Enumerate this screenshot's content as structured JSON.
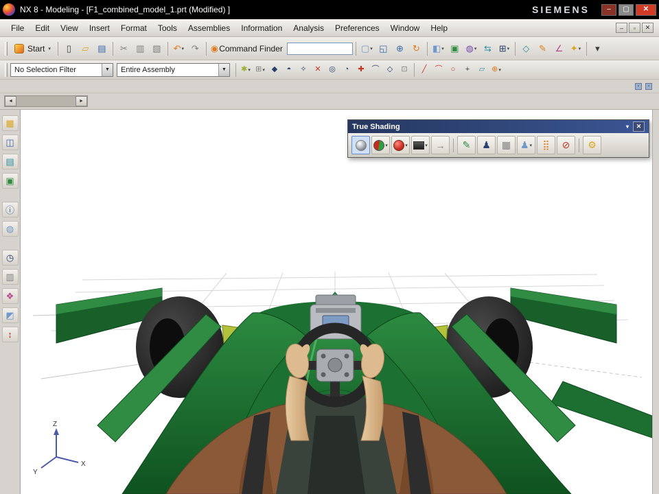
{
  "ui": {
    "caret": "▾",
    "combo_arrow": "▼",
    "scroll_left": "◄",
    "scroll_right": "►",
    "close": "✕"
  },
  "window": {
    "title": "NX 8 - Modeling - [F1_combined_model_1.prt (Modified) ]",
    "brand": "SIEMENS",
    "controls": [
      {
        "name": "minimize",
        "glyph": "–"
      },
      {
        "name": "maximize",
        "glyph": "▢"
      },
      {
        "name": "close",
        "glyph": "✕"
      }
    ]
  },
  "menu": {
    "items": [
      "File",
      "Edit",
      "View",
      "Insert",
      "Format",
      "Tools",
      "Assemblies",
      "Information",
      "Analysis",
      "Preferences",
      "Window",
      "Help"
    ],
    "doc_controls": [
      {
        "name": "minimize-document",
        "glyph": "–"
      },
      {
        "name": "restore-document",
        "glyph": "▫"
      },
      {
        "name": "close-document",
        "glyph": "✕"
      }
    ]
  },
  "toolbar_main": {
    "start_label": "Start",
    "command_finder_label": "Command Finder",
    "command_finder_value": "",
    "icons": [
      {
        "name": "new-file",
        "glyph": "▯"
      },
      {
        "name": "open-file",
        "glyph": "▱"
      },
      {
        "name": "save",
        "glyph": "▤"
      },
      {
        "name": "cut",
        "glyph": "✂"
      },
      {
        "name": "copy",
        "glyph": "▥"
      },
      {
        "name": "paste",
        "glyph": "▧"
      },
      {
        "name": "undo",
        "glyph": "↶"
      },
      {
        "name": "redo",
        "glyph": "↷"
      },
      {
        "name": "command-finder",
        "glyph": "◉"
      },
      {
        "name": "screen-split",
        "glyph": "▢"
      },
      {
        "name": "fit-view",
        "glyph": "◱"
      },
      {
        "name": "zoom",
        "glyph": "⊕"
      },
      {
        "name": "rotate-view",
        "glyph": "↻"
      },
      {
        "name": "rendering-style",
        "glyph": "◧"
      },
      {
        "name": "assembly-display",
        "glyph": "▣"
      },
      {
        "name": "show-and-hide",
        "glyph": "◍"
      },
      {
        "name": "move-component",
        "glyph": "⇆"
      },
      {
        "name": "assembly-constraints",
        "glyph": "⊞"
      },
      {
        "name": "datum-plane",
        "glyph": "◇"
      },
      {
        "name": "sketch",
        "glyph": "✎"
      },
      {
        "name": "measure",
        "glyph": "∠"
      },
      {
        "name": "assign-material",
        "glyph": "✦"
      },
      {
        "name": "toolbar-options",
        "glyph": "▾"
      }
    ]
  },
  "toolbar_selection": {
    "filter_value": "No Selection Filter",
    "scope_value": "Entire Assembly",
    "icons": [
      {
        "name": "enable-snap-point",
        "glyph": "✱"
      },
      {
        "name": "grid-point",
        "glyph": "⊞"
      },
      {
        "name": "end-point",
        "glyph": "◆"
      },
      {
        "name": "mid-point",
        "glyph": "◓"
      },
      {
        "name": "control-point",
        "glyph": "✧"
      },
      {
        "name": "intersection-point",
        "glyph": "✕"
      },
      {
        "name": "arc-center",
        "glyph": "◎"
      },
      {
        "name": "quadrant-point",
        "glyph": "◔"
      },
      {
        "name": "existing-point",
        "glyph": "✚"
      },
      {
        "name": "point-on-curve",
        "glyph": "⌒"
      },
      {
        "name": "point-on-surface",
        "glyph": "◇"
      },
      {
        "name": "bounded-grid-point",
        "glyph": "⊡"
      },
      {
        "name": "line",
        "glyph": "╱"
      },
      {
        "name": "arc",
        "glyph": "⌒"
      },
      {
        "name": "circle",
        "glyph": "○"
      },
      {
        "name": "point-constructor",
        "glyph": "+"
      },
      {
        "name": "plane",
        "glyph": "▱"
      },
      {
        "name": "csys",
        "glyph": "⊕"
      }
    ]
  },
  "strip": {
    "icons": [
      {
        "name": "dock-indicator-1",
        "glyph": "▪"
      },
      {
        "name": "dock-indicator-2",
        "glyph": "▪"
      }
    ]
  },
  "resource_bar": {
    "icons": [
      {
        "name": "assembly-navigator",
        "glyph": "▦"
      },
      {
        "name": "constraint-navigator",
        "glyph": "◫"
      },
      {
        "name": "part-navigator",
        "glyph": "▤"
      },
      {
        "name": "reuse-library",
        "glyph": "▣"
      },
      {
        "name": "hd3d-tools",
        "glyph": "ⓘ"
      },
      {
        "name": "web-browser",
        "glyph": "◍"
      },
      {
        "name": "history",
        "glyph": "◷"
      },
      {
        "name": "process-studio",
        "glyph": "▥"
      },
      {
        "name": "roles",
        "glyph": "❖"
      },
      {
        "name": "system-materials",
        "glyph": "◩"
      },
      {
        "name": "manufacturing-wizards",
        "glyph": "↕"
      }
    ]
  },
  "true_shading": {
    "title": "True Shading",
    "icons": [
      {
        "name": "true-shading-toggle",
        "glyph": ""
      },
      {
        "name": "global-material",
        "glyph": ""
      },
      {
        "name": "material-ball",
        "glyph": ""
      },
      {
        "name": "background",
        "glyph": ""
      },
      {
        "name": "stage",
        "glyph": "→"
      },
      {
        "name": "edit-object-display",
        "glyph": "✎"
      },
      {
        "name": "show-human",
        "glyph": "♟"
      },
      {
        "name": "ground-plane",
        "glyph": "▦"
      },
      {
        "name": "human-style",
        "glyph": "♟"
      },
      {
        "name": "color-palette",
        "glyph": "⣿"
      },
      {
        "name": "disable-true-shading",
        "glyph": "⊘"
      },
      {
        "name": "true-shading-preferences",
        "glyph": "⚙"
      }
    ]
  },
  "viewport": {
    "triad": {
      "z": "Z",
      "x": "X",
      "y": "Y"
    }
  },
  "colors": {
    "title_bar": "#000000",
    "toolbar": "#d6d3ce",
    "panel_header": "#2e4476",
    "viewport_bg": "#ffffff",
    "car_green": "#1e7a34",
    "close_red": "#d23b26"
  }
}
